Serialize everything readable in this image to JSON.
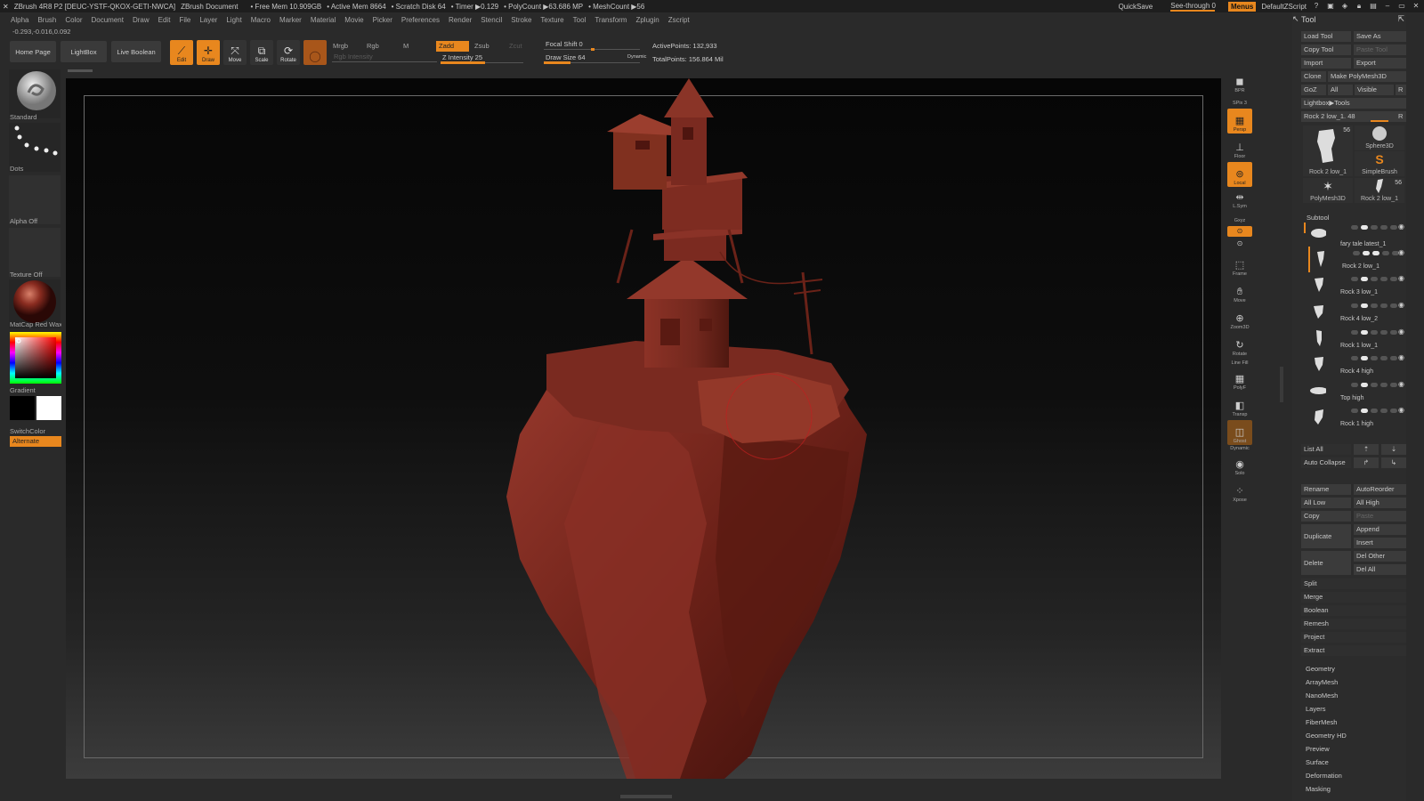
{
  "titlebar": {
    "app": "ZBrush 4R8 P2 [DEUC-YSTF-QKOX-GETI-NWCA]",
    "document": "ZBrush Document",
    "free_mem": "• Free Mem 10.909GB",
    "active_mem": "• Active Mem 8664",
    "scratch": "• Scratch Disk 64",
    "timer": "• Timer ▶0.129",
    "polycount": "• PolyCount ▶63.686 MP",
    "meshcount": "• MeshCount ▶56",
    "quicksave": "QuickSave",
    "seethrough": "See-through",
    "seethrough_val": "0",
    "menus": "Menus",
    "defaultzscript": "DefaultZScript"
  },
  "menubar": [
    "Alpha",
    "Brush",
    "Color",
    "Document",
    "Draw",
    "Edit",
    "File",
    "Layer",
    "Light",
    "Macro",
    "Marker",
    "Material",
    "Movie",
    "Picker",
    "Preferences",
    "Render",
    "Stencil",
    "Stroke",
    "Texture",
    "Tool",
    "Transform",
    "Zplugin",
    "Zscript"
  ],
  "coord_readout": "-0.293,-0.016,0.092",
  "shelf": {
    "home_page": "Home Page",
    "lightbox": "LightBox",
    "live_boolean": "Live Boolean",
    "edit": "Edit",
    "draw": "Draw",
    "move": "Move",
    "scale": "Scale",
    "rotate": "Rotate",
    "mrgb": "Mrgb",
    "rgb": "Rgb",
    "m": "M",
    "rgb_intensity": "Rgb Intensity",
    "zadd": "Zadd",
    "zsub": "Zsub",
    "zcut": "Zcut",
    "z_intensity": "Z Intensity 25",
    "z_intensity_value": 25,
    "focal_shift": "Focal Shift 0",
    "focal_shift_value": 0,
    "draw_size": "Draw Size 64",
    "draw_size_value": 64,
    "dynamic": "Dynamic",
    "active_points": "ActivePoints: 132,933",
    "total_points": "TotalPoints: 156.864 Mil"
  },
  "lefttray": {
    "brush": "Standard",
    "stroke": "Dots",
    "alpha": "Alpha Off",
    "texture": "Texture Off",
    "material": "MatCap Red Wax",
    "gradient": "Gradient",
    "switchcolor": "SwitchColor",
    "alternate": "Alternate"
  },
  "rightshelf": {
    "bpr": "BPR",
    "spix": "SPix 3",
    "persp": "Persp",
    "floor": "Floor",
    "local": "Local",
    "lsym": "L.Sym",
    "gxyz": "Gxyz",
    "frame": "Frame",
    "move": "Move",
    "zoom3d": "Zoom3D",
    "rotate": "Rotate",
    "linefill": "Line Fill",
    "polyf": "PolyF",
    "transp": "Transp",
    "ghost": "Ghost",
    "dynamic": "Dynamic",
    "solo": "Solo",
    "xpose": "Xpose"
  },
  "toolpalette": {
    "title": "Tool",
    "load_tool": "Load Tool",
    "save_as": "Save As",
    "copy_tool": "Copy Tool",
    "paste_tool": "Paste Tool",
    "import": "Import",
    "export": "Export",
    "clone": "Clone",
    "make_polymesh": "Make PolyMesh3D",
    "goz": "GoZ",
    "all": "All",
    "visible": "Visible",
    "r": "R",
    "lightbox_tools": "Lightbox▶Tools",
    "current_tool": "Rock 2 low_1. 48",
    "current_tool_r": "R",
    "thumbs": [
      {
        "name": "Rock 2 low_1",
        "count": "56"
      },
      {
        "name": "Sphere3D",
        "count": ""
      },
      {
        "name": "SimpleBrush",
        "count": ""
      },
      {
        "name": "PolyMesh3D",
        "count": ""
      },
      {
        "name": "Rock 2 low_1",
        "count": "56"
      }
    ],
    "subtool_title": "Subtool",
    "subtools": [
      "",
      "fary tale latest_1",
      "Rock 2 low_1",
      "Rock 3 low_1",
      "Rock 4 low_2",
      "Rock 1 low_1",
      "Rock 4 high",
      "Top high",
      "Rock 1 high"
    ],
    "list_all": "List All",
    "auto_collapse": "Auto Collapse",
    "rename": "Rename",
    "autoreorder": "AutoReorder",
    "all_low": "All Low",
    "all_high": "All High",
    "copy": "Copy",
    "paste": "Paste",
    "duplicate": "Duplicate",
    "append": "Append",
    "insert": "Insert",
    "delete": "Delete",
    "del_other": "Del Other",
    "del_all": "Del All",
    "split": "Split",
    "merge": "Merge",
    "boolean": "Boolean",
    "remesh": "Remesh",
    "project": "Project",
    "extract": "Extract",
    "sections": [
      "Geometry",
      "ArrayMesh",
      "NanoMesh",
      "Layers",
      "FiberMesh",
      "Geometry HD",
      "Preview",
      "Surface",
      "Deformation",
      "Masking"
    ]
  },
  "colors": {
    "accent": "#e8871e",
    "model": "#7a2a22"
  }
}
